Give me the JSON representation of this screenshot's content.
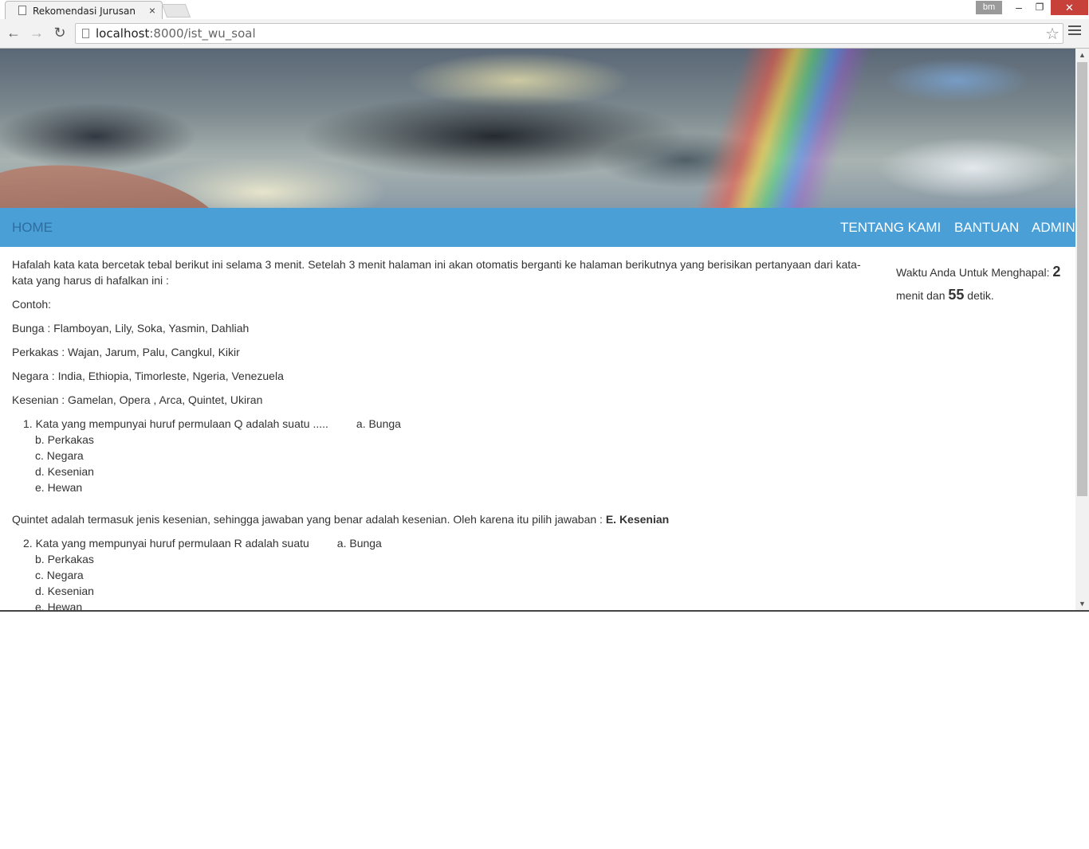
{
  "browser": {
    "tab_title": "Rekomendasi Jurusan",
    "tab_close": "×",
    "user_badge": "bm",
    "win_min": "–",
    "win_max": "❐",
    "win_close": "✕",
    "back": "←",
    "forward": "→",
    "reload": "↻",
    "url_host": "localhost",
    "url_rest": ":8000/ist_wu_soal",
    "star": "☆"
  },
  "nav": {
    "home": "HOME",
    "about": "TENTANG KAMI",
    "help": "BANTUAN",
    "admin": "ADMIN"
  },
  "content": {
    "intro": "Hafalah kata kata bercetak tebal berikut ini selama 3 menit. Setelah 3 menit halaman ini akan otomatis berganti ke halaman berikutnya yang berisikan pertanyaan dari kata-kata yang harus di hafalkan ini :",
    "example_label": "Contoh:",
    "categories": [
      "Bunga : Flamboyan, Lily, Soka, Yasmin, Dahliah",
      "Perkakas : Wajan, Jarum, Palu, Cangkul, Kikir",
      "Negara : India, Ethiopia, Timorleste, Ngeria, Venezuela",
      "Kesenian : Gamelan, Opera , Arca, Quintet, Ukiran"
    ],
    "q1": {
      "text": "1. Kata yang mempunyai huruf permulaan Q adalah suatu .....         a. Bunga",
      "options": [
        "b. Perkakas",
        "c. Negara",
        "d. Kesenian",
        "e. Hewan"
      ]
    },
    "explanation": "Quintet adalah termasuk jenis kesenian, sehingga jawaban yang benar adalah kesenian. Oleh karena itu pilih jawaban :",
    "explanation_answer": "E. Kesenian",
    "q2": {
      "text": "2. Kata yang mempunyai huruf permulaan R adalah suatu         a. Bunga",
      "options": [
        "b. Perkakas",
        "c. Negara",
        "d. Kesenian",
        "e. Hewan"
      ]
    }
  },
  "timer": {
    "label": "Waktu Anda Untuk Menghapal:",
    "minutes": "2",
    "minutes_label": "menit dan",
    "seconds": "55",
    "seconds_label": "detik."
  },
  "colors": {
    "navbar": "#4a9fd6",
    "home_link": "#2d6da0"
  }
}
